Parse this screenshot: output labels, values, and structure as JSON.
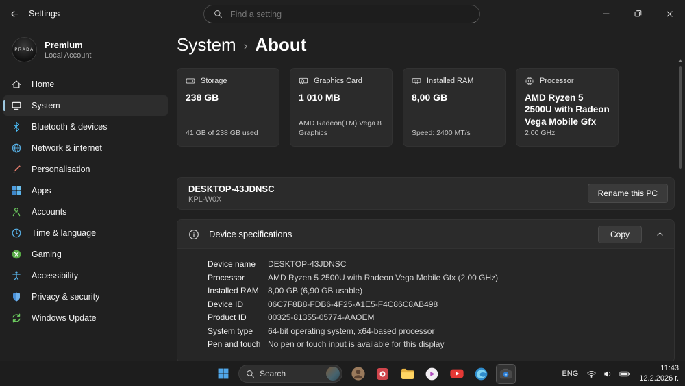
{
  "titlebar": {
    "app_name": "Settings",
    "search_placeholder": "Find a setting"
  },
  "sidebar": {
    "user": {
      "name": "Premium",
      "type": "Local Account",
      "avatar_text": "PRADA"
    },
    "items": [
      {
        "label": "Home",
        "icon": "home-icon"
      },
      {
        "label": "System",
        "icon": "system-icon",
        "selected": true
      },
      {
        "label": "Bluetooth & devices",
        "icon": "bluetooth-icon"
      },
      {
        "label": "Network & internet",
        "icon": "network-icon"
      },
      {
        "label": "Personalisation",
        "icon": "personalisation-icon"
      },
      {
        "label": "Apps",
        "icon": "apps-icon"
      },
      {
        "label": "Accounts",
        "icon": "accounts-icon"
      },
      {
        "label": "Time & language",
        "icon": "time-language-icon"
      },
      {
        "label": "Gaming",
        "icon": "gaming-icon"
      },
      {
        "label": "Accessibility",
        "icon": "accessibility-icon"
      },
      {
        "label": "Privacy & security",
        "icon": "privacy-icon"
      },
      {
        "label": "Windows Update",
        "icon": "windows-update-icon"
      }
    ]
  },
  "breadcrumb": {
    "root": "System",
    "separator": "›",
    "current": "About"
  },
  "cards": [
    {
      "label": "Storage",
      "icon": "storage-icon",
      "value": "238 GB",
      "detail": "41 GB of 238 GB used"
    },
    {
      "label": "Graphics Card",
      "icon": "gpu-icon",
      "value": "1 010 MB",
      "detail": "AMD Radeon(TM) Vega 8 Graphics"
    },
    {
      "label": "Installed RAM",
      "icon": "ram-icon",
      "value": "8,00 GB",
      "detail": "Speed: 2400 MT/s"
    },
    {
      "label": "Processor",
      "icon": "cpu-icon",
      "value": "AMD Ryzen 5 2500U with Radeon Vega Mobile Gfx",
      "detail": "2.00 GHz"
    }
  ],
  "device": {
    "name": "DESKTOP-43JDNSC",
    "model": "KPL-W0X",
    "rename_button": "Rename this PC"
  },
  "specs": {
    "title": "Device specifications",
    "copy_button": "Copy",
    "rows": [
      {
        "label": "Device name",
        "value": "DESKTOP-43JDNSC"
      },
      {
        "label": "Processor",
        "value": "AMD Ryzen 5 2500U with Radeon Vega Mobile Gfx   (2.00 GHz)"
      },
      {
        "label": "Installed RAM",
        "value": "8,00 GB (6,90 GB usable)"
      },
      {
        "label": "Device ID",
        "value": "06C7F8B8-FDB6-4F25-A1E5-F4C86C8AB498"
      },
      {
        "label": "Product ID",
        "value": "00325-81355-05774-AAOEM"
      },
      {
        "label": "System type",
        "value": "64-bit operating system, x64-based processor"
      },
      {
        "label": "Pen and touch",
        "value": "No pen or touch input is available for this display"
      }
    ]
  },
  "taskbar": {
    "search_placeholder": "Search",
    "tray": {
      "language": "ENG",
      "time": "11:43",
      "date": "12.2.2026 г."
    }
  },
  "colors": {
    "accent": "#4cc2ff",
    "selected_indicator": "#9ec9e2",
    "card_background": "#2b2b2b",
    "page_background": "#202020"
  }
}
